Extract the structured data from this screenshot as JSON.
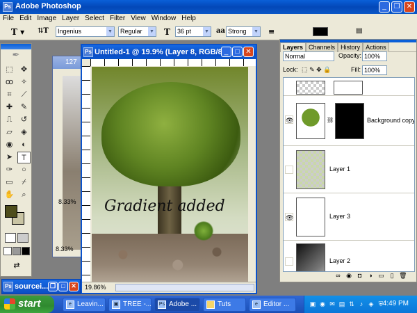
{
  "app": {
    "title": "Adobe Photoshop",
    "icon": "ps-icon"
  },
  "window_controls": {
    "minimize": "_",
    "restore": "❐",
    "close": "✕"
  },
  "menu": [
    "File",
    "Edit",
    "Image",
    "Layer",
    "Select",
    "Filter",
    "View",
    "Window",
    "Help"
  ],
  "options_bar": {
    "font_family": "Ingenius",
    "font_style": "Regular",
    "font_size": "36 pt",
    "aa_label": "a",
    "anti_alias": "Strong"
  },
  "bg_doc": {
    "title": "127",
    "zoom_top": "8.33%",
    "zoom_bottom": "8.33%"
  },
  "main_doc": {
    "title": "Untitled-1 @ 19.9% (Layer 8, RGB/8)",
    "canvas_text": "Gradient added",
    "zoom": "19.86%"
  },
  "layers_panel": {
    "tabs": [
      "Layers",
      "Channels",
      "History",
      "Actions"
    ],
    "blend_mode": "Normal",
    "opacity_label": "Opacity:",
    "opacity": "100%",
    "lock_label": "Lock:",
    "fill_label": "Fill:",
    "fill": "100%",
    "layers": [
      {
        "name": "Background copy",
        "visible": true
      },
      {
        "name": "Layer 1",
        "visible": false
      },
      {
        "name": "Layer 3",
        "visible": true
      },
      {
        "name": "Layer 2",
        "visible": false
      }
    ]
  },
  "minimized_window": {
    "title": "sourcei..."
  },
  "taskbar": {
    "start": "start",
    "items": [
      {
        "label": "Leavin..."
      },
      {
        "label": "TREE -..."
      },
      {
        "label": "Adobe ..."
      },
      {
        "label": "Tuts"
      },
      {
        "label": "Editor ..."
      }
    ],
    "clock": "4:49 PM"
  }
}
